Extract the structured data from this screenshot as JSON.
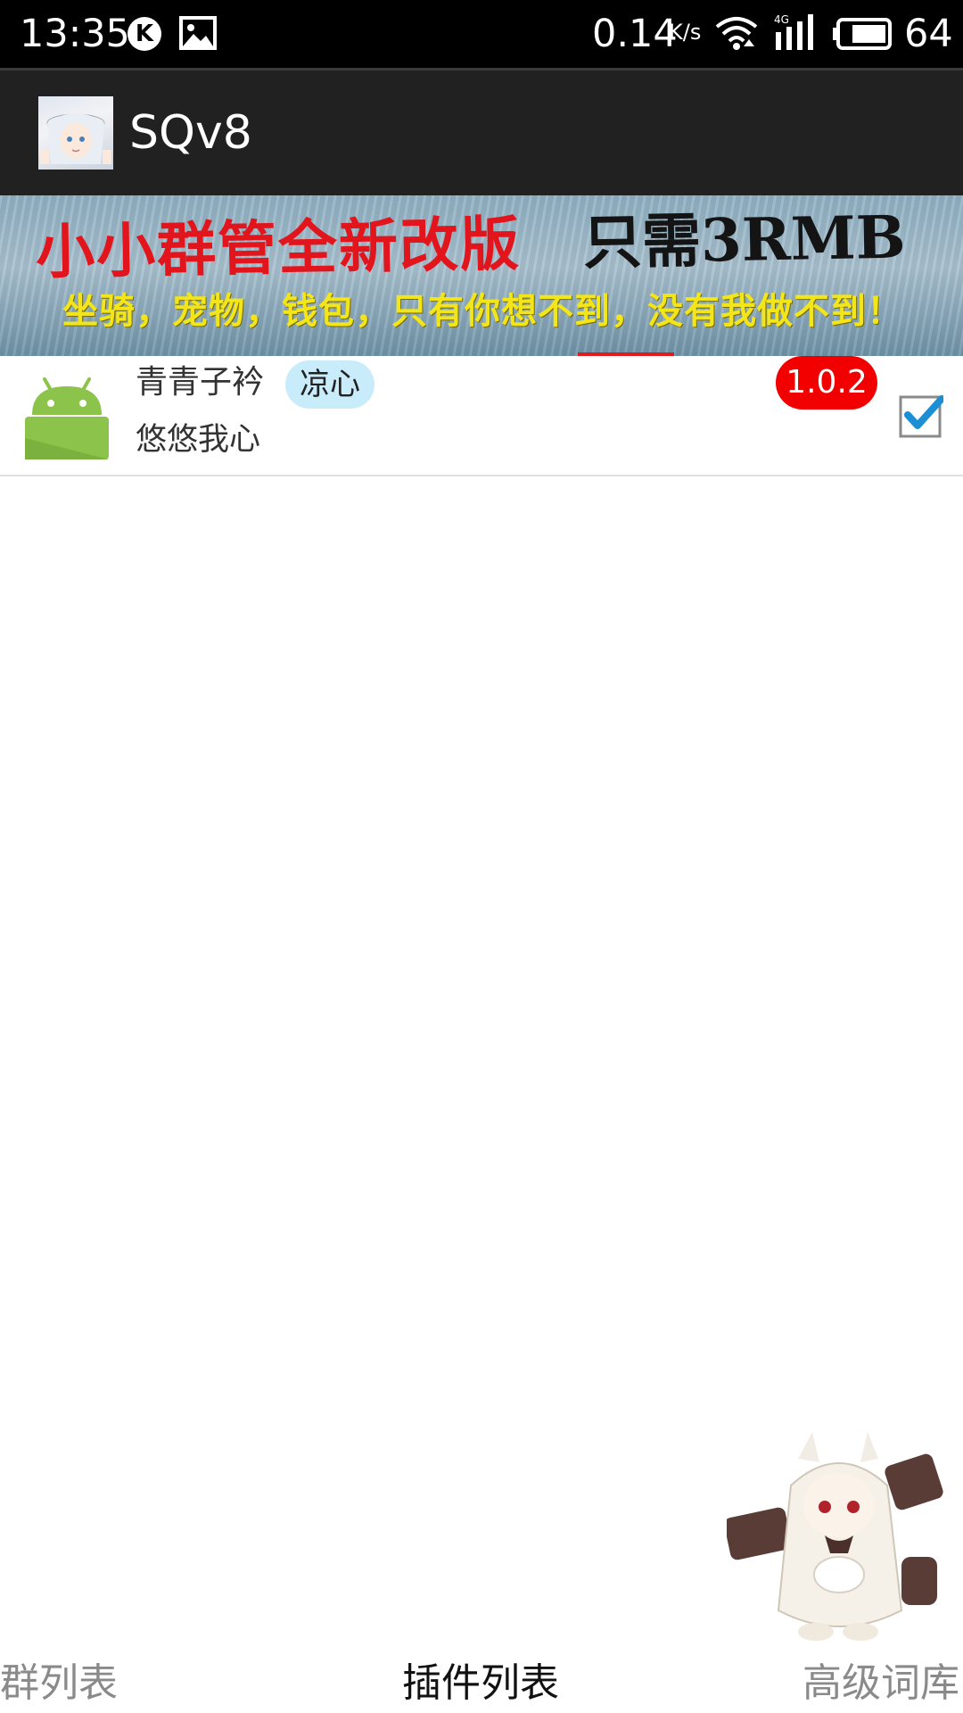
{
  "status_bar": {
    "time": "13:35",
    "k_icon_label": "K",
    "net_speed": "0.14",
    "net_unit": "K/s",
    "network_type": "4G",
    "battery": "64"
  },
  "app_bar": {
    "title": "SQv8"
  },
  "banner": {
    "line1_red": "小小群管全新改版",
    "line1_black": "只需3RMB",
    "line2": "坐骑，宠物，钱包，只有你想不到，没有我做不到！"
  },
  "plugin_list": {
    "items": [
      {
        "name": "青青子衿",
        "tag": "凉心",
        "desc": "悠悠我心",
        "version": "1.0.2",
        "checked": true
      }
    ]
  },
  "bottom_tabs": {
    "groups": "群列表",
    "plugins": "插件列表",
    "lexicon": "高级词库"
  },
  "colors": {
    "status_bar_bg": "#000000",
    "app_bar_bg": "#212121",
    "version_badge": "#f20000",
    "tag_bg": "#c9ecfb",
    "banner_indicator": "#e01b1b",
    "android_green": "#8cc34a",
    "checkbox_check": "#1a8fd6"
  },
  "icons": {
    "status": [
      "k-app-icon",
      "image-icon",
      "wifi-icon",
      "signal-icon",
      "battery-icon"
    ],
    "plugin": "android-icon",
    "checkbox": "checkbox-icon"
  }
}
